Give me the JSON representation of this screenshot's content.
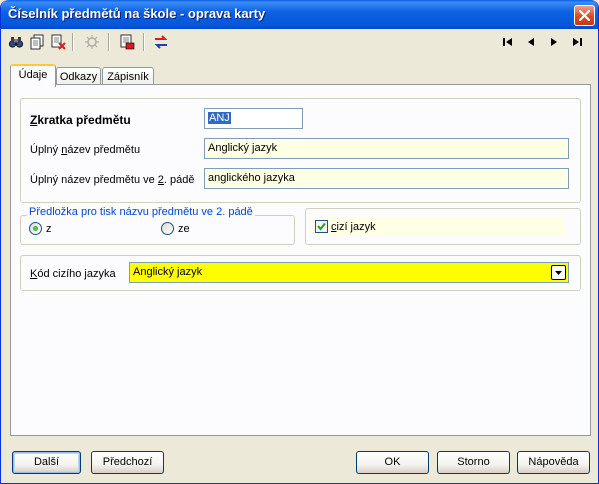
{
  "window": {
    "title": "Číselník předmětů na škole - oprava karty"
  },
  "toolbar": {
    "buttons": [
      "search-binoculars-icon",
      "copy-document-icon",
      "delete-document-icon",
      "disabled-gear-icon",
      "print-document-icon",
      "swap-arrows-icon"
    ],
    "nav": [
      "|◀",
      "◀",
      "▶",
      "▶|"
    ]
  },
  "tabs": [
    "Údaje",
    "Odkazy",
    "Zápisník"
  ],
  "form": {
    "zkratka_label_u": "Z",
    "zkratka_label_rest": "kratka předmětu",
    "zkratka_value": "ANJ",
    "nazev_label_pre": "Úplný ",
    "nazev_label_u": "n",
    "nazev_label_post": "ázev předmětu",
    "nazev_value": "Anglický jazyk",
    "nazev2_label_pre": "Úplný název předmětu ve ",
    "nazev2_label_u": "2",
    "nazev2_label_post": ". pádě",
    "nazev2_value": "anglického jazyka"
  },
  "predlozka": {
    "caption": "Předložka pro tisk názvu předmětu ve 2. pádě",
    "option_z": "z",
    "option_ze": "ze",
    "selected": "z"
  },
  "cizi_jazyk": {
    "label_u": "c",
    "label_rest": "izí jazyk",
    "checked": true
  },
  "kod": {
    "label_u": "K",
    "label_rest": "ód cizího jazyka",
    "value": "Anglický jazyk"
  },
  "buttons": {
    "dalsi": "Další",
    "predchozi": "Předchozí",
    "ok": "OK",
    "storno": "Storno",
    "napoveda": "Nápověda"
  },
  "colors": {
    "titlebar": "#0F62E2",
    "field_bg": "#FFFFE5",
    "highlight_field": "#FFFF00",
    "group_caption": "#0046D5"
  }
}
